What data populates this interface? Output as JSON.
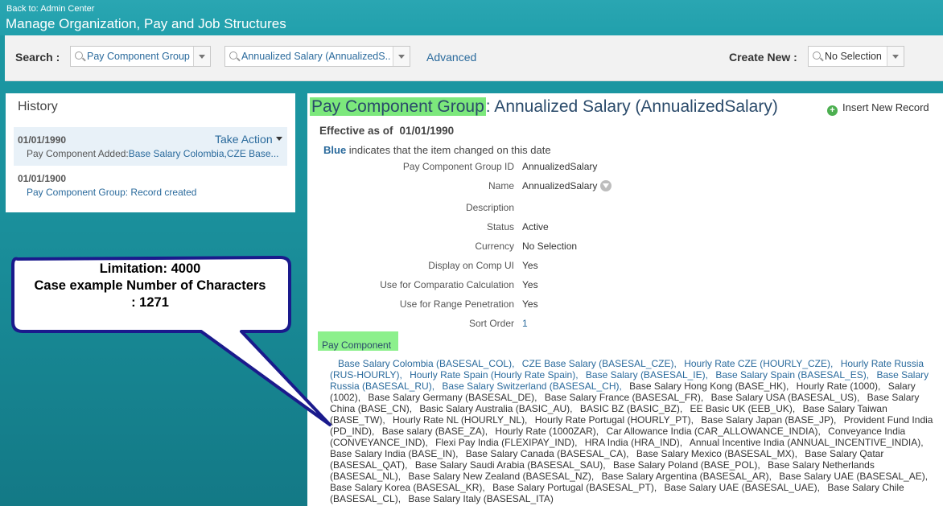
{
  "header": {
    "back_link": "Back to: Admin Center",
    "title": "Manage Organization, Pay and Job Structures"
  },
  "search": {
    "label": "Search :",
    "type_value": "Pay Component Group",
    "record_value": "Annualized Salary (AnnualizedS...",
    "advanced_label": "Advanced",
    "create_new_label": "Create New :",
    "create_new_value": "No Selection"
  },
  "history": {
    "title": "History",
    "items": [
      {
        "date": "01/01/1990",
        "action_label": "Take Action",
        "prefix": "Pay Component Added:",
        "detail": "Base Salary Colombia,CZE Base..."
      },
      {
        "date": "01/01/1900",
        "detail": "Pay Component Group: Record created"
      }
    ]
  },
  "record": {
    "heading_type": "Pay Component Group",
    "heading_rest": ": Annualized Salary (AnnualizedSalary)",
    "insert_label": "Insert New Record",
    "effective_label": "Effective as of",
    "effective_date": "01/01/1990",
    "note_bold": "Blue",
    "note_rest": " indicates that the item changed on this date",
    "fields": [
      {
        "label": "Pay Component Group ID",
        "value": "AnnualizedSalary"
      },
      {
        "label": "Name",
        "value": "AnnualizedSalary"
      },
      {
        "label": "Description",
        "value": ""
      },
      {
        "label": "Status",
        "value": "Active"
      },
      {
        "label": "Currency",
        "value": "No Selection"
      },
      {
        "label": "Display on Comp UI",
        "value": "Yes"
      },
      {
        "label": "Use for Comparatio Calculation",
        "value": "Yes"
      },
      {
        "label": "Use for Range Penetration",
        "value": "Yes"
      },
      {
        "label": "Sort Order",
        "value": "1"
      }
    ],
    "pay_component_label": "Pay Component",
    "pay_components": [
      {
        "text": "Base Salary Colombia (BASESAL_COL),",
        "changed": true
      },
      {
        "text": "CZE Base Salary (BASESAL_CZE),",
        "changed": true
      },
      {
        "text": "Hourly Rate CZE (HOURLY_CZE),",
        "changed": true
      },
      {
        "text": "Hourly Rate Russia (RUS-HOURLY),",
        "changed": true
      },
      {
        "text": "Hourly Rate Spain (Hourly Rate Spain),",
        "changed": true
      },
      {
        "text": "Base Salary (BASESAL_IE),",
        "changed": true
      },
      {
        "text": "Base Salary Spain (BASESAL_ES),",
        "changed": true
      },
      {
        "text": "Base Salary Russia (BASESAL_RU),",
        "changed": true
      },
      {
        "text": "Base Salary Switzerland (BASESAL_CH),",
        "changed": true
      },
      {
        "text": "Base Salary Hong Kong (BASE_HK),",
        "changed": false
      },
      {
        "text": "Hourly Rate (1000),",
        "changed": false
      },
      {
        "text": "Salary (1002),",
        "changed": false
      },
      {
        "text": "Base Salary Germany (BASESAL_DE),",
        "changed": false
      },
      {
        "text": "Base Salary France (BASESAL_FR),",
        "changed": false
      },
      {
        "text": "Base Salary USA (BASESAL_US),",
        "changed": false
      },
      {
        "text": "Base Salary China (BASE_CN),",
        "changed": false
      },
      {
        "text": "Basic Salary Australia (BASIC_AU),",
        "changed": false
      },
      {
        "text": "BASIC BZ (BASIC_BZ),",
        "changed": false
      },
      {
        "text": "EE Basic UK (EEB_UK),",
        "changed": false
      },
      {
        "text": "Base Salary Taiwan (BASE_TW),",
        "changed": false
      },
      {
        "text": "Hourly Rate NL (HOURLY_NL),",
        "changed": false
      },
      {
        "text": "Hourly Rate Portugal (HOURLY_PT),",
        "changed": false
      },
      {
        "text": "Base Salary Japan (BASE_JP),",
        "changed": false
      },
      {
        "text": "Provident Fund India (PD_IND),",
        "changed": false
      },
      {
        "text": "Base salary (BASE_ZA),",
        "changed": false
      },
      {
        "text": "Hourly Rate (1000ZAR),",
        "changed": false
      },
      {
        "text": "Car Allowance India (CAR_ALLOWANCE_INDIA),",
        "changed": false
      },
      {
        "text": "Conveyance India (CONVEYANCE_IND),",
        "changed": false
      },
      {
        "text": "Flexi Pay India (FLEXIPAY_IND),",
        "changed": false
      },
      {
        "text": "HRA India (HRA_IND),",
        "changed": false
      },
      {
        "text": "Annual Incentive India (ANNUAL_INCENTIVE_INDIA),",
        "changed": false
      },
      {
        "text": "Base Salary India (BASE_IN),",
        "changed": false
      },
      {
        "text": "Base Salary Canada (BASESAL_CA),",
        "changed": false
      },
      {
        "text": "Base Salary Mexico (BASESAL_MX),",
        "changed": false
      },
      {
        "text": "Base Salary Qatar (BASESAL_QAT),",
        "changed": false
      },
      {
        "text": "Base Salary Saudi Arabia (BASESAL_SAU),",
        "changed": false
      },
      {
        "text": "Base Salary Poland (BASE_POL),",
        "changed": false
      },
      {
        "text": "Base Salary Netherlands (BASESAL_NL),",
        "changed": false
      },
      {
        "text": "Base Salary New Zealand (BASESAL_NZ),",
        "changed": false
      },
      {
        "text": "Base Salary Argentina (BASESAL_AR),",
        "changed": false
      },
      {
        "text": "Base Salary UAE (BASESAL_AE),",
        "changed": false
      },
      {
        "text": "Base Salary Korea (BASESAL_KR),",
        "changed": false
      },
      {
        "text": "Base Salary Portugal (BASESAL_PT),",
        "changed": false
      },
      {
        "text": "Base Salary UAE (BASESAL_UAE),",
        "changed": false
      },
      {
        "text": "Base Salary Chile (BASESAL_CL),",
        "changed": false
      },
      {
        "text": "Base Salary Italy (BASESAL_ITA)",
        "changed": false
      }
    ]
  },
  "callout": {
    "line1": "Limitation: 4000",
    "line2": "Case example Number of Characters",
    "line3": ": 1271"
  },
  "colors": {
    "highlight": "#7ce87c",
    "link_blue": "#2a6a9c",
    "callout_fill": "#1a1a8c"
  }
}
